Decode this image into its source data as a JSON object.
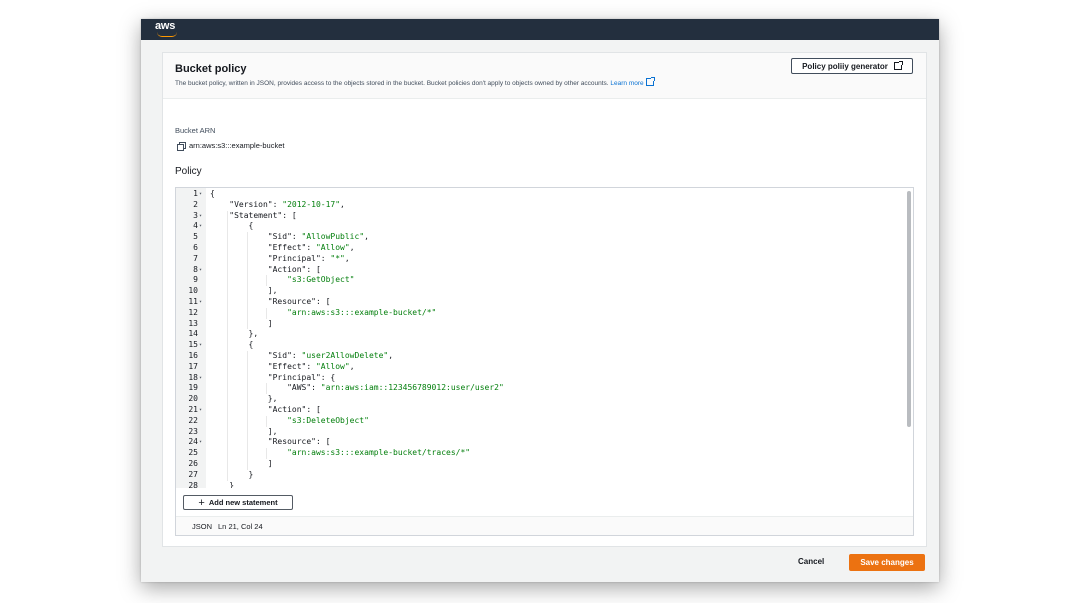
{
  "brand": {
    "logo_text": "aws",
    "accent": "#ff9900",
    "topbar_color": "#232f3e"
  },
  "panel": {
    "title": "Bucket policy",
    "description": "The bucket policy, written in JSON, provides access to the objects stored in the bucket. Bucket policies don't apply to objects owned by other accounts.",
    "learn_more": "Learn more",
    "generator_button": "Policy poliiy generator"
  },
  "arn": {
    "label": "Bucket ARN",
    "value": "arn:aws:s3:::example-bucket"
  },
  "policy": {
    "label": "Policy",
    "code_lines": [
      "{",
      "    \"Version\": \"2012-10-17\",",
      "    \"Statement\": [",
      "        {",
      "            \"Sid\": \"AllowPublic\",",
      "            \"Effect\": \"Allow\",",
      "            \"Principal\": \"*\",",
      "            \"Action\": [",
      "                \"s3:GetObject\"",
      "            ],",
      "            \"Resource\": [",
      "                \"arn:aws:s3:::example-bucket/*\"",
      "            ]",
      "        },",
      "        {",
      "            \"Sid\": \"user2AllowDelete\",",
      "            \"Effect\": \"Allow\",",
      "            \"Principal\": {",
      "                \"AWS\": \"arn:aws:iam::123456789012:user/user2\"",
      "            },",
      "            \"Action\": [",
      "                \"s3:DeleteObject\"",
      "            ],",
      "            \"Resource\": [",
      "                \"arn:aws:s3:::example-bucket/traces/*\"",
      "            ]",
      "        }",
      "    }"
    ],
    "foldable_lines": [
      1,
      3,
      4,
      8,
      11,
      15,
      18,
      21,
      24
    ],
    "add_statement_button": "Add new statement",
    "status_mode": "JSON",
    "status_cursor": "Ln 21, Col 24"
  },
  "footer": {
    "cancel": "Cancel",
    "save": "Save changes",
    "save_color": "#ec7211"
  }
}
